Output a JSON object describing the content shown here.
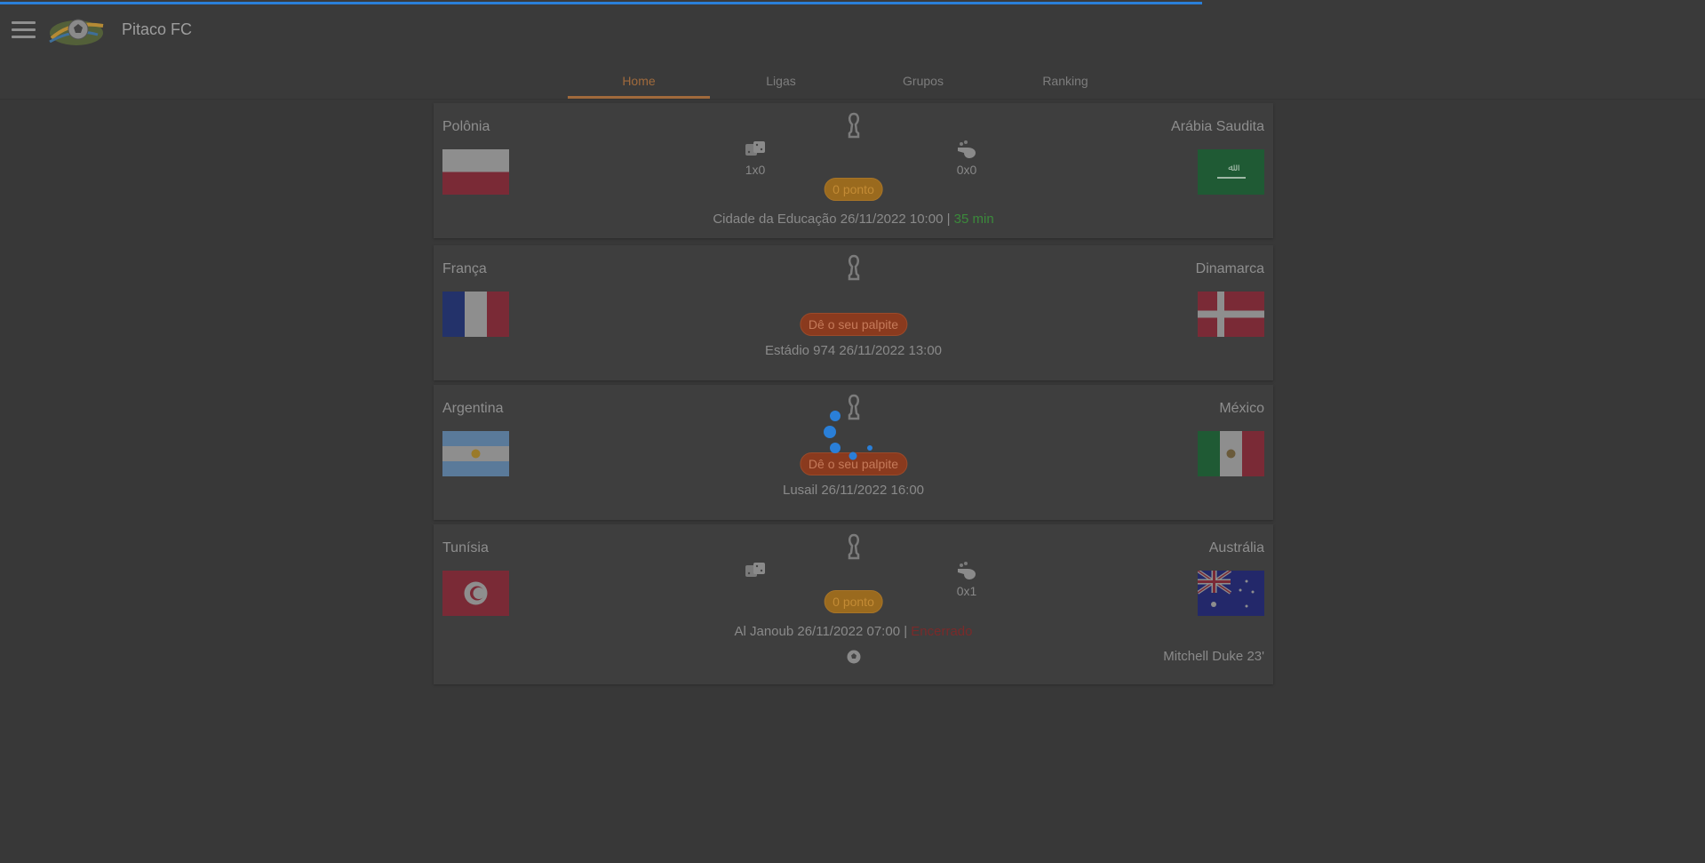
{
  "app": {
    "title": "Pitaco FC",
    "progress_percent": 70.5
  },
  "tabs": [
    {
      "label": "Home",
      "active": true
    },
    {
      "label": "Ligas",
      "active": false
    },
    {
      "label": "Grupos",
      "active": false
    },
    {
      "label": "Ranking",
      "active": false
    }
  ],
  "matches": [
    {
      "home": "Polônia",
      "away": "Arábia Saudita",
      "home_flag": "poland-flag",
      "away_flag": "saudi-arabia-flag",
      "user_guess_score": "1x0",
      "group_guess_score": "0x0",
      "pill": "0 ponto",
      "venue_time": "Cidade da Educação 26/11/2022 10:00",
      "separator": " | ",
      "status": "35 min"
    },
    {
      "home": "França",
      "away": "Dinamarca",
      "home_flag": "france-flag",
      "away_flag": "denmark-flag",
      "pill": "Dê o seu palpite",
      "venue_time": "Estádio 974 26/11/2022 13:00"
    },
    {
      "home": "Argentina",
      "away": "México",
      "home_flag": "argentina-flag",
      "away_flag": "mexico-flag",
      "pill": "Dê o seu palpite",
      "venue_time": "Lusail 26/11/2022 16:00"
    },
    {
      "home": "Tunísia",
      "away": "Austrália",
      "home_flag": "tunisia-flag",
      "away_flag": "australia-flag",
      "group_guess_score": "0x1",
      "pill": "0 ponto",
      "venue_time": "Al Janoub 26/11/2022 07:00",
      "separator": " | ",
      "status": "Encerrado",
      "scorer": "Mitchell Duke 23'"
    }
  ],
  "colors": {
    "accent": "#a06a3c",
    "progress": "#2a7fd8",
    "live": "#3b8a3b",
    "ended": "#7a2a2a"
  }
}
